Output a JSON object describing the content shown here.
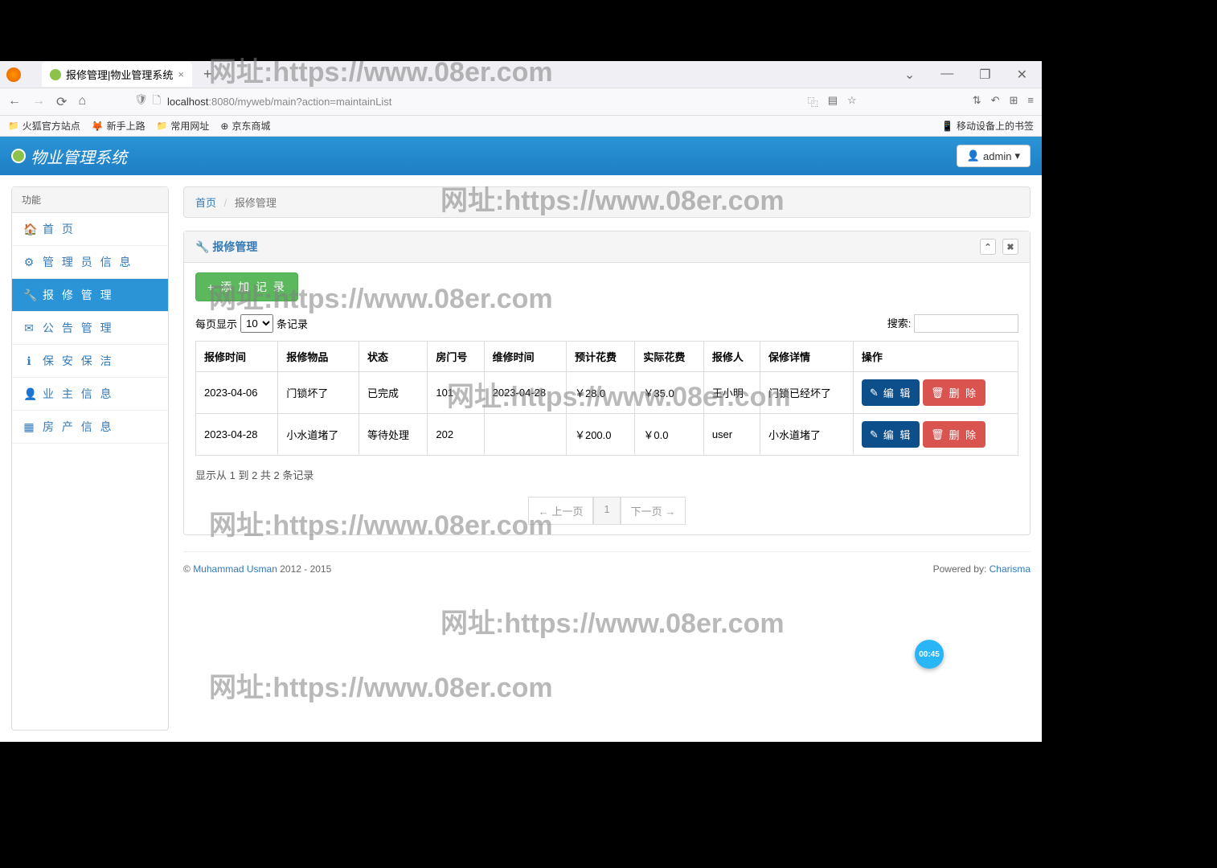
{
  "browser": {
    "tab_title": "报修管理|物业管理系统",
    "url_host": "localhost",
    "url_path": ":8080/myweb/main?action=maintainList",
    "bookmarks": [
      "火狐官方站点",
      "新手上路",
      "常用网址",
      "京东商城"
    ],
    "mobile_bookmark": "移动设备上的书签"
  },
  "app": {
    "title": "物业管理系统",
    "user": "admin"
  },
  "sidebar": {
    "title": "功能",
    "items": [
      {
        "icon": "🏠",
        "label": "首 页"
      },
      {
        "icon": "⚙",
        "label": "管 理 员 信 息"
      },
      {
        "icon": "🔧",
        "label": "报 修 管 理"
      },
      {
        "icon": "✉",
        "label": "公 告 管 理"
      },
      {
        "icon": "ℹ",
        "label": "保 安 保 洁"
      },
      {
        "icon": "👤",
        "label": "业 主 信 息"
      },
      {
        "icon": "▦",
        "label": "房 产 信 息"
      }
    ]
  },
  "breadcrumb": {
    "home": "首页",
    "current": "报修管理"
  },
  "panel": {
    "title": "报修管理",
    "add_btn": "添 加 记 录",
    "per_page_label_pre": "每页显示",
    "per_page_value": "10",
    "per_page_label_post": "条记录",
    "search_label": "搜索:",
    "columns": [
      "报修时间",
      "报修物品",
      "状态",
      "房门号",
      "维修时间",
      "预计花费",
      "实际花费",
      "报修人",
      "保修详情",
      "操作"
    ],
    "rows": [
      {
        "cells": [
          "2023-04-06",
          "门锁坏了",
          "已完成",
          "101",
          "2023-04-28",
          "￥28.0",
          "￥35.0",
          "王小明",
          "门锁已经坏了"
        ]
      },
      {
        "cells": [
          "2023-04-28",
          "小水道堵了",
          "等待处理",
          "202",
          "",
          "￥200.0",
          "￥0.0",
          "user",
          "小水道堵了"
        ]
      }
    ],
    "edit_label": "编 辑",
    "delete_label": "删 除",
    "info_text": "显示从 1 到 2 共 2 条记录",
    "prev": "← 上一页",
    "page": "1",
    "next": "下一页 →"
  },
  "footer": {
    "copyright_pre": "© ",
    "author": "Muhammad Usman",
    "copyright_post": " 2012 - 2015",
    "powered_pre": "Powered by: ",
    "powered_link": "Charisma"
  },
  "timer": "00:45",
  "watermark": "网址:https://www.08er.com"
}
